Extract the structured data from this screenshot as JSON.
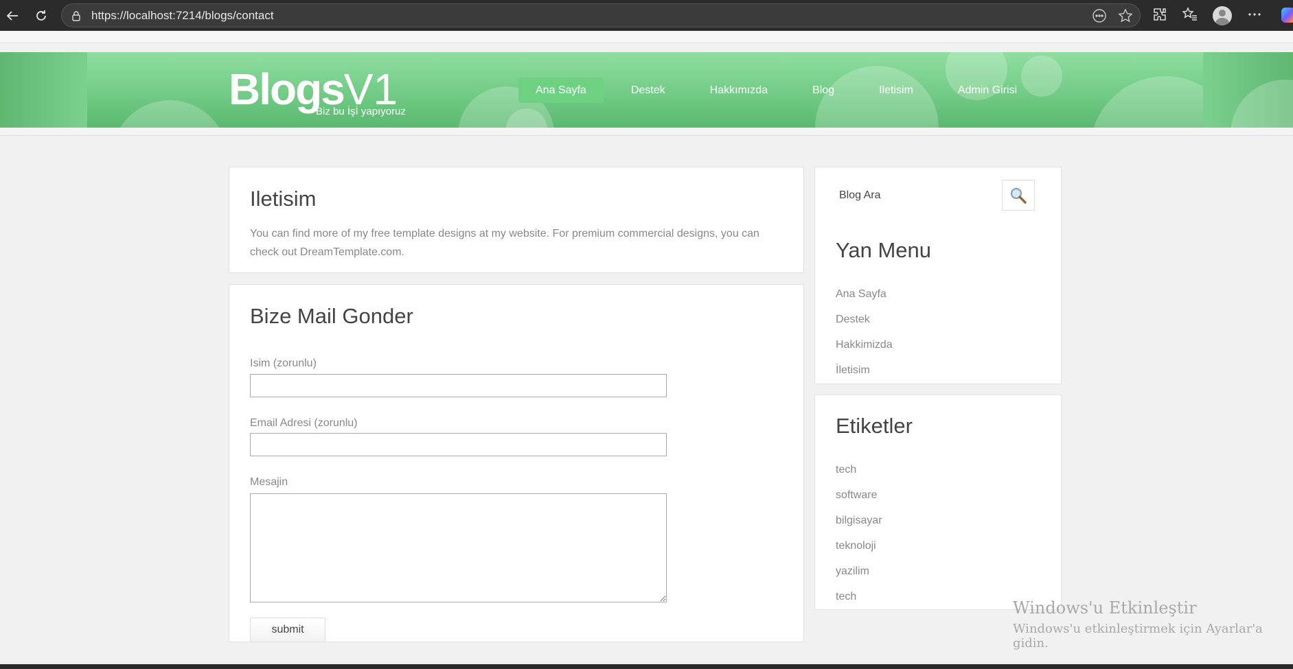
{
  "browser": {
    "url": "https://localhost:7214/blogs/contact"
  },
  "header": {
    "logo_main": "Blogs",
    "logo_suffix": "V1",
    "tagline": "Biz bu İşİ yapıyoruz",
    "nav": [
      {
        "label": "Ana Sayfa",
        "active": true
      },
      {
        "label": "Destek"
      },
      {
        "label": "Hakkımızda"
      },
      {
        "label": "Blog"
      },
      {
        "label": "Iletisim"
      },
      {
        "label": "Admin Girisi"
      }
    ]
  },
  "contact": {
    "title": "Iletisim",
    "text": "You can find more of my free template designs at my website. For premium commercial designs, you can check out DreamTemplate.com."
  },
  "form": {
    "title": "Bize Mail Gonder",
    "name_label": "Isim (zorunlu)",
    "email_label": "Email Adresi (zorunlu)",
    "message_label": "Mesajin",
    "submit_label": "submit"
  },
  "sidebar": {
    "search_placeholder": "Blog Ara",
    "menu_title": "Yan Menu",
    "menu_items": [
      "Ana Sayfa",
      "Destek",
      "Hakkimizda",
      "İletisim"
    ],
    "tags_title": "Etiketler",
    "tags": [
      "tech",
      "software",
      "bilgisayar",
      "teknoloji",
      "yazilim",
      "tech"
    ]
  },
  "watermark": {
    "title": "Windows'u Etkinleştir",
    "subtitle": "Windows'u etkinleştirmek için Ayarlar'a gidin."
  },
  "colors": {
    "header_green": "#72cb86",
    "nav_active": "#6ed182"
  }
}
